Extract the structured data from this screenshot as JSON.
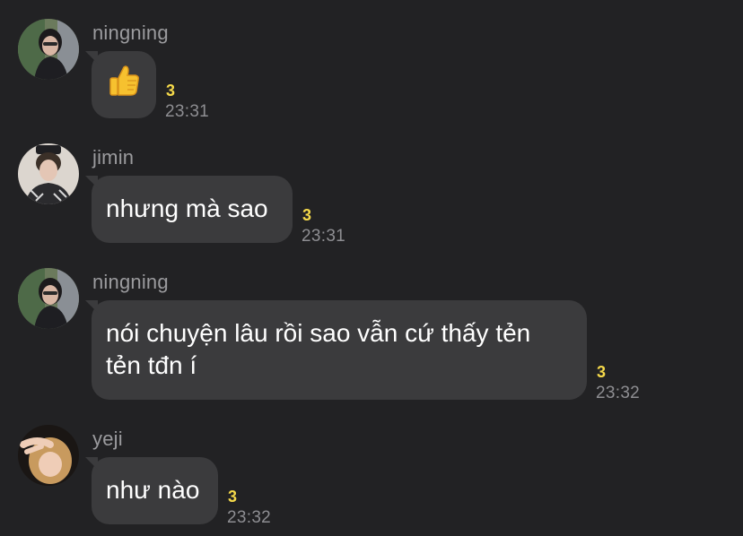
{
  "messages": [
    {
      "sender": "ningning",
      "avatar_icon": "ningning-avatar",
      "text": "",
      "emoji": "thumbs-up-emoji",
      "unread_count": "3",
      "time": "23:31"
    },
    {
      "sender": "jimin",
      "avatar_icon": "jimin-avatar",
      "text": "nhưng mà sao",
      "unread_count": "3",
      "time": "23:31"
    },
    {
      "sender": "ningning",
      "avatar_icon": "ningning-avatar",
      "text": "nói chuyện lâu rồi sao vẫn cứ thấy tẻn\ntẻn tđn í",
      "unread_count": "3",
      "time": "23:32"
    },
    {
      "sender": "yeji",
      "avatar_icon": "yeji-avatar",
      "text": "như nào",
      "unread_count": "3",
      "time": "23:32"
    }
  ],
  "colors": {
    "background": "#222224",
    "bubble": "#3b3b3d",
    "sender_name": "#9b9b9e",
    "unread": "#f5d94a",
    "time": "#8e8e92"
  }
}
